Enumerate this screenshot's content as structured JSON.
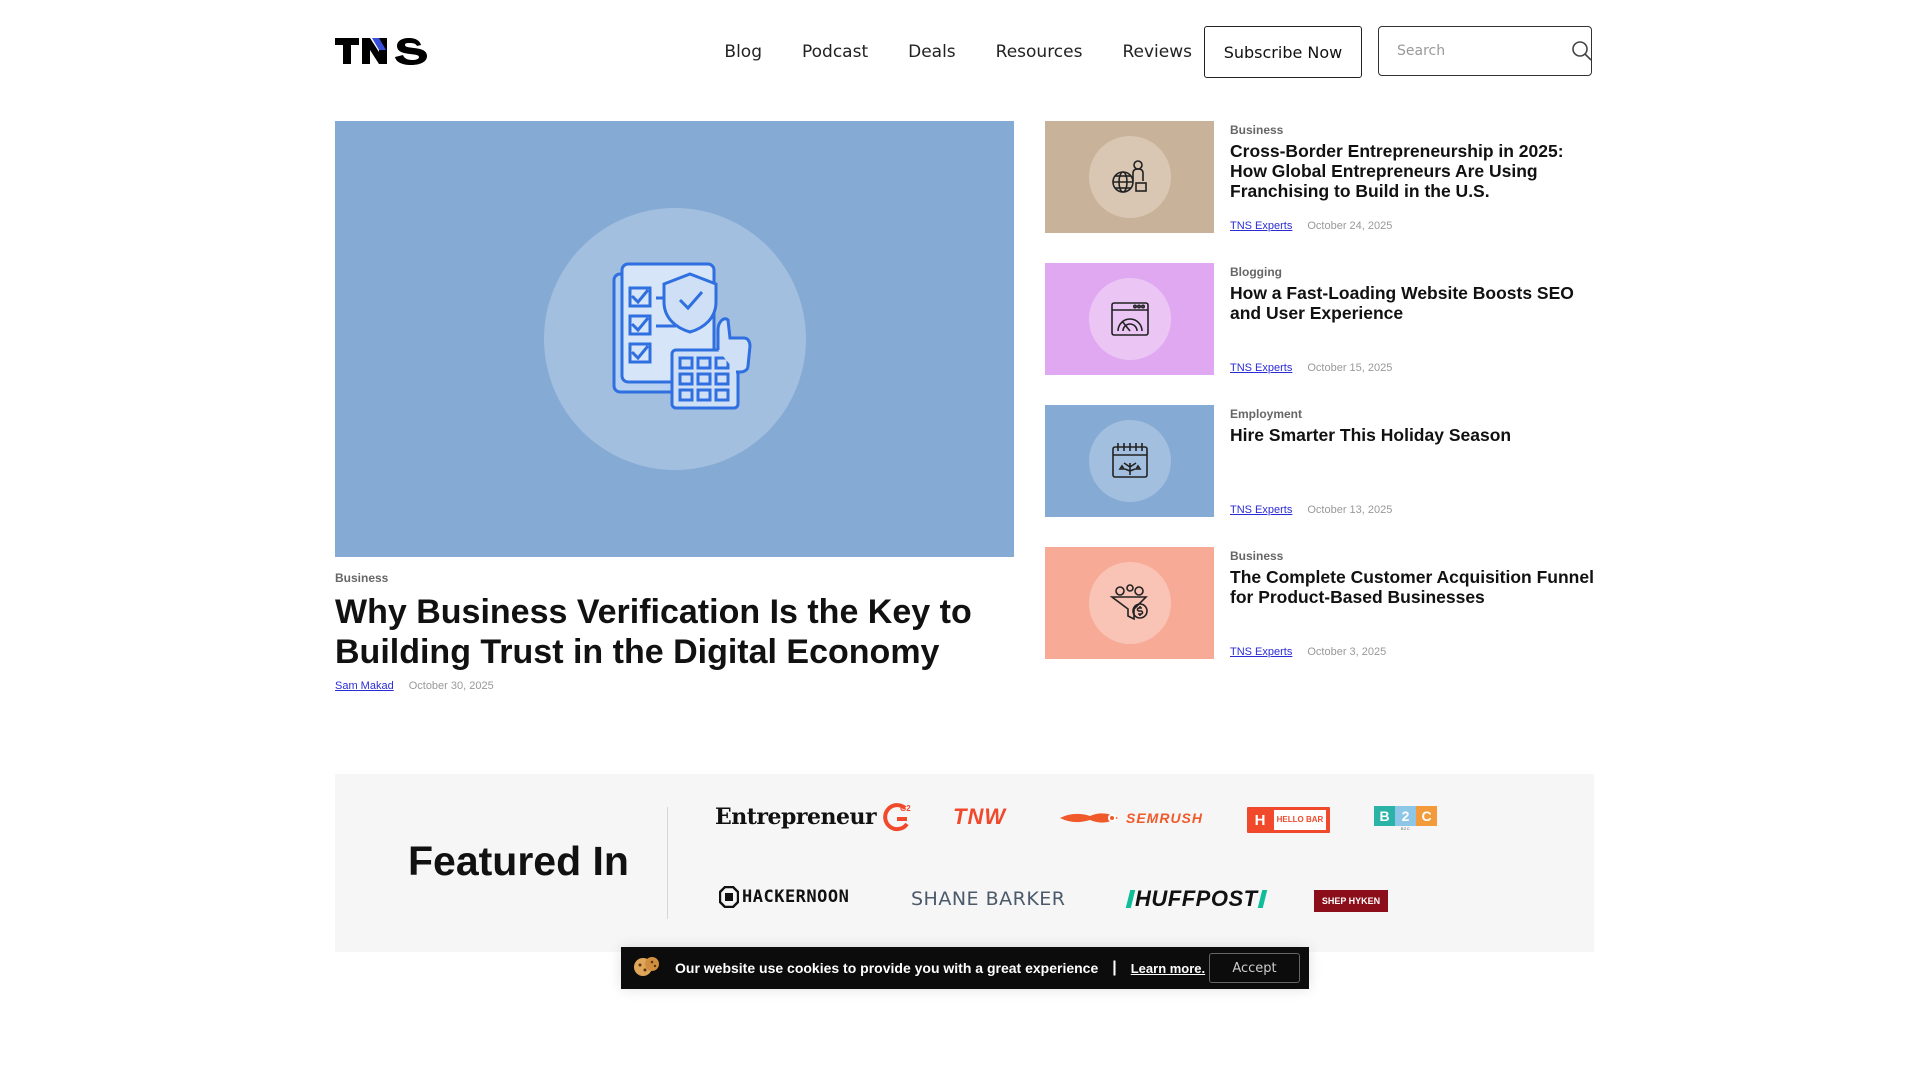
{
  "header": {
    "logo_text": "TNS",
    "nav": [
      "Blog",
      "Podcast",
      "Deals",
      "Resources",
      "Reviews"
    ],
    "subscribe_label": "Subscribe Now",
    "search_placeholder": "Search"
  },
  "hero": {
    "category": "Business",
    "title": "Why Business Verification Is the Key to Building Trust in the Digital Economy",
    "author": "Sam Makad",
    "date": "October 30, 2025",
    "image_color": "#85aad3"
  },
  "side_articles": [
    {
      "category": "Business",
      "title": "Cross-Border Entrepreneurship in 2025: How Global Entrepreneurs Are Using Franchising to Build in the U.S.",
      "author": "TNS Experts",
      "date": "October 24, 2025",
      "image_color": "#c9b29a",
      "icon": "globe-person-icon"
    },
    {
      "category": "Blogging",
      "title": "How a Fast-Loading Website Boosts SEO and User Experience",
      "author": "TNS Experts",
      "date": "October 15, 2025",
      "image_color": "#e0a8f0",
      "icon": "website-speed-icon"
    },
    {
      "category": "Employment",
      "title": "Hire Smarter This Holiday Season",
      "author": "TNS Experts",
      "date": "October 13, 2025",
      "image_color": "#85aad3",
      "icon": "holiday-calendar-icon"
    },
    {
      "category": "Business",
      "title": "The Complete Customer Acquisition Funnel for Product-Based Businesses",
      "author": "TNS Experts",
      "date": "October 3, 2025",
      "image_color": "#f7ab97",
      "icon": "funnel-dollar-icon"
    }
  ],
  "featured": {
    "title": "Featured In",
    "brands": [
      "Entrepreneur",
      "G2",
      "TNW",
      "SEMRUSH",
      "HELLO BAR",
      "B2C",
      "HACKERNOON",
      "SHANE BARKER",
      "HUFFPOST",
      "SHEP HYKEN"
    ]
  },
  "cookie": {
    "text": "Our website use cookies to provide you with a great experience",
    "separator": "|",
    "link": "Learn more.",
    "accept": "Accept"
  }
}
